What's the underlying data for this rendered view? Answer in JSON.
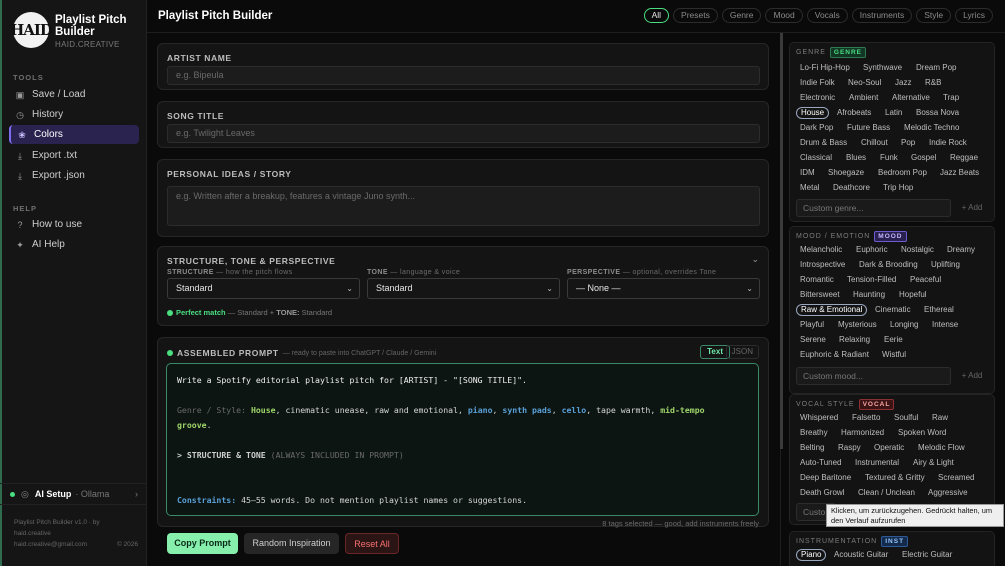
{
  "app": {
    "logo_text": "HAID",
    "title": "Playlist Pitch Builder",
    "subtitle": "HAID.CREATIVE"
  },
  "sidebar": {
    "tools_label": "TOOLS",
    "tools": [
      {
        "label": "Save / Load",
        "icon": "save-icon"
      },
      {
        "label": "History",
        "icon": "history-icon"
      },
      {
        "label": "Colors",
        "icon": "palette-icon"
      },
      {
        "label": "Export .txt",
        "icon": "download-icon"
      },
      {
        "label": "Export .json",
        "icon": "download-icon"
      }
    ],
    "help_label": "HELP",
    "help": [
      {
        "label": "How to use",
        "icon": "help-icon"
      },
      {
        "label": "AI Help",
        "icon": "ai-icon"
      }
    ],
    "ai_setup": {
      "label": "AI Setup",
      "model": "· Ollama"
    },
    "footer": {
      "line1": "Playlist Pitch Builder v1.0 · by",
      "line2": "haid.creative",
      "email": "haid.creative@gmail.com",
      "year": "© 2026"
    }
  },
  "header": {
    "title": "Playlist Pitch Builder",
    "tabs": [
      "All",
      "Presets",
      "Genre",
      "Mood",
      "Vocals",
      "Instruments",
      "Style",
      "Lyrics"
    ]
  },
  "form": {
    "artist": {
      "label": "ARTIST NAME",
      "placeholder": "e.g. Bipeula"
    },
    "song": {
      "label": "SONG TITLE",
      "placeholder": "e.g. Twilight Leaves"
    },
    "ideas": {
      "label": "PERSONAL IDEAS / STORY",
      "placeholder": "e.g. Written after a breakup, features a vintage Juno synth..."
    },
    "structure": {
      "title": "STRUCTURE, TONE & PERSPECTIVE",
      "structure_label": "STRUCTURE",
      "structure_hint": "— how the pitch flows",
      "structure_value": "Standard",
      "tone_label": "TONE",
      "tone_hint": "— language & voice",
      "tone_value": "Standard",
      "perspective_label": "PERSPECTIVE",
      "perspective_hint": "— optional, overrides Tone",
      "perspective_value": "— None —",
      "match_label": "Perfect match",
      "match_detail": "— Standard +",
      "match_tone": "TONE:",
      "match_tone_value": "Standard"
    }
  },
  "prompt": {
    "title": "ASSEMBLED PROMPT",
    "hint": "— ready to paste into ChatGPT / Claude / Gemini",
    "fmt_text": "Text",
    "fmt_json": "JSON",
    "line1": "Write a Spotify editorial playlist pitch for [ARTIST] - \"[SONG TITLE]\".",
    "genre_prefix": "Genre / Style:",
    "house": "House",
    "t1": ", cinematic unease, raw and emotional,",
    "piano": "piano",
    "t2": ",",
    "synth": "synth pads",
    "t3": ",",
    "cello": "cello",
    "t4": ", tape warmth,",
    "groove1": "mid-tempo",
    "groove2": "groove",
    "dot": ".",
    "struct": "> STRUCTURE & TONE",
    "struct_dim": "(ALWAYS INCLUDED IN PROMPT)",
    "constraints_label": "Constraints:",
    "constraints": "45–55 words. Do not mention playlist names or suggestions.",
    "status": "8 tags selected — good, add instruments freely"
  },
  "actions": {
    "copy": "Copy Prompt",
    "random": "Random Inspiration",
    "reset": "Reset All"
  },
  "panels": {
    "genre": {
      "title": "GENRE",
      "badge": "GENRE",
      "custom": "Custom genre...",
      "add": "+ Add",
      "selected": "House",
      "tags": [
        "Lo-Fi Hip-Hop",
        "Synthwave",
        "Dream Pop",
        "Indie Folk",
        "Neo-Soul",
        "Jazz",
        "R&B",
        "Electronic",
        "Ambient",
        "Alternative",
        "Trap",
        "House",
        "Afrobeats",
        "Latin",
        "Bossa Nova",
        "Dark Pop",
        "Future Bass",
        "Melodic Techno",
        "Drum & Bass",
        "Chillout",
        "Pop",
        "Indie Rock",
        "Classical",
        "Blues",
        "Funk",
        "Gospel",
        "Reggae",
        "IDM",
        "Shoegaze",
        "Bedroom Pop",
        "Jazz Beats",
        "Metal",
        "Deathcore",
        "Trip Hop"
      ]
    },
    "mood": {
      "title": "MOOD / EMOTION",
      "badge": "MOOD",
      "custom": "Custom mood...",
      "add": "+ Add",
      "selected": "Raw & Emotional",
      "tags": [
        "Melancholic",
        "Euphoric",
        "Nostalgic",
        "Dreamy",
        "Introspective",
        "Dark & Brooding",
        "Uplifting",
        "Romantic",
        "Tension-Filled",
        "Peaceful",
        "Bittersweet",
        "Haunting",
        "Hopeful",
        "Raw & Emotional",
        "Cinematic",
        "Ethereal",
        "Playful",
        "Mysterious",
        "Longing",
        "Intense",
        "Serene",
        "Relaxing",
        "Eerie",
        "Euphoric & Radiant",
        "Wistful"
      ]
    },
    "vocal": {
      "title": "VOCAL STYLE",
      "badge": "VOCAL",
      "custom": "Custo",
      "tags": [
        "Whispered",
        "Falsetto",
        "Soulful",
        "Raw",
        "Breathy",
        "Harmonized",
        "Spoken Word",
        "Belting",
        "Raspy",
        "Operatic",
        "Melodic Flow",
        "Auto-Tuned",
        "Instrumental",
        "Airy & Light",
        "Deep Baritone",
        "Textured & Gritty",
        "Screamed",
        "Death Growl",
        "Clean / Unclean",
        "Aggressive"
      ]
    },
    "instr": {
      "title": "INSTRUMENTATION",
      "badge": "INST",
      "selected": "Piano",
      "tags": [
        "Piano",
        "Acoustic Guitar",
        "Electric Guitar"
      ]
    }
  },
  "tooltip": "Klicken, um zurückzugehen. Gedrückt halten, um den Verlauf aufzurufen",
  "colors": {
    "accent": "#4ade80",
    "nav_active": "#2a2350",
    "genre": "#4ade80",
    "mood": "#a78bfa",
    "vocal": "#f87171",
    "inst": "#60a5fa"
  }
}
